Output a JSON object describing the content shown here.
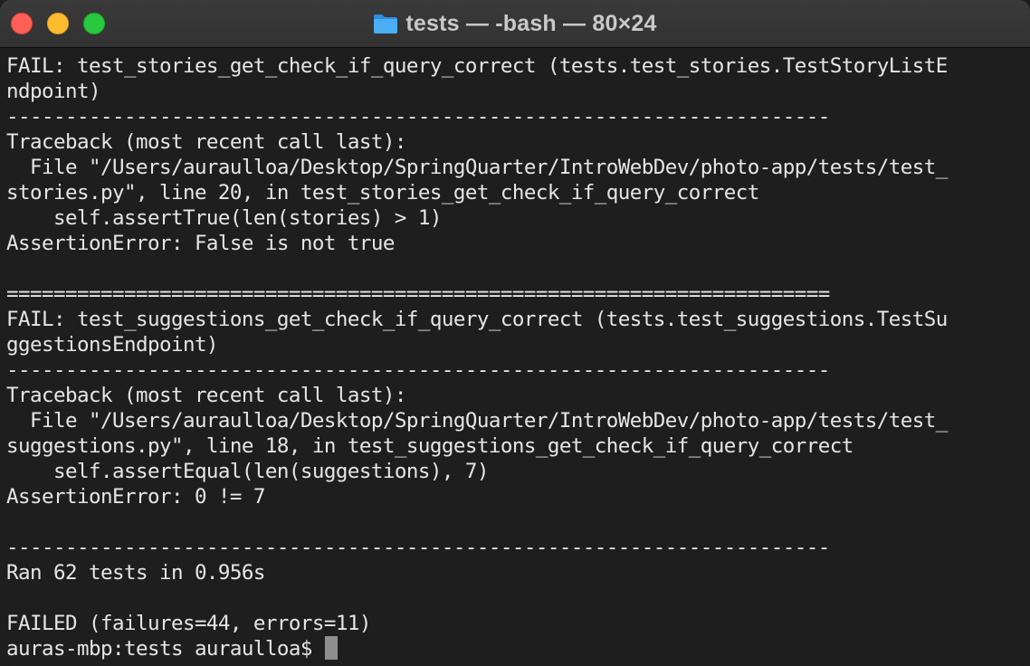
{
  "window": {
    "title": "tests — -bash — 80×24"
  },
  "icons": {
    "folder": "folder-icon",
    "close": "close-button",
    "minimize": "minimize-button",
    "zoom": "zoom-button"
  },
  "colors": {
    "background": "#1e1e1e",
    "text": "#e6e6e6",
    "close": "#fe5f57",
    "minimize": "#febc2e",
    "zoom": "#28c840",
    "folder": "#3ea3f2"
  },
  "terminal": {
    "lines": [
      "FAIL: test_stories_get_check_if_query_correct (tests.test_stories.TestStoryListE",
      "ndpoint)",
      "----------------------------------------------------------------------",
      "Traceback (most recent call last):",
      "  File \"/Users/auraulloa/Desktop/SpringQuarter/IntroWebDev/photo-app/tests/test_",
      "stories.py\", line 20, in test_stories_get_check_if_query_correct",
      "    self.assertTrue(len(stories) > 1)",
      "AssertionError: False is not true",
      "",
      "======================================================================",
      "FAIL: test_suggestions_get_check_if_query_correct (tests.test_suggestions.TestSu",
      "ggestionsEndpoint)",
      "----------------------------------------------------------------------",
      "Traceback (most recent call last):",
      "  File \"/Users/auraulloa/Desktop/SpringQuarter/IntroWebDev/photo-app/tests/test_",
      "suggestions.py\", line 18, in test_suggestions_get_check_if_query_correct",
      "    self.assertEqual(len(suggestions), 7)",
      "AssertionError: 0 != 7",
      "",
      "----------------------------------------------------------------------",
      "Ran 62 tests in 0.956s",
      "",
      "FAILED (failures=44, errors=11)"
    ],
    "prompt": "auras-mbp:tests auraulloa$ "
  }
}
